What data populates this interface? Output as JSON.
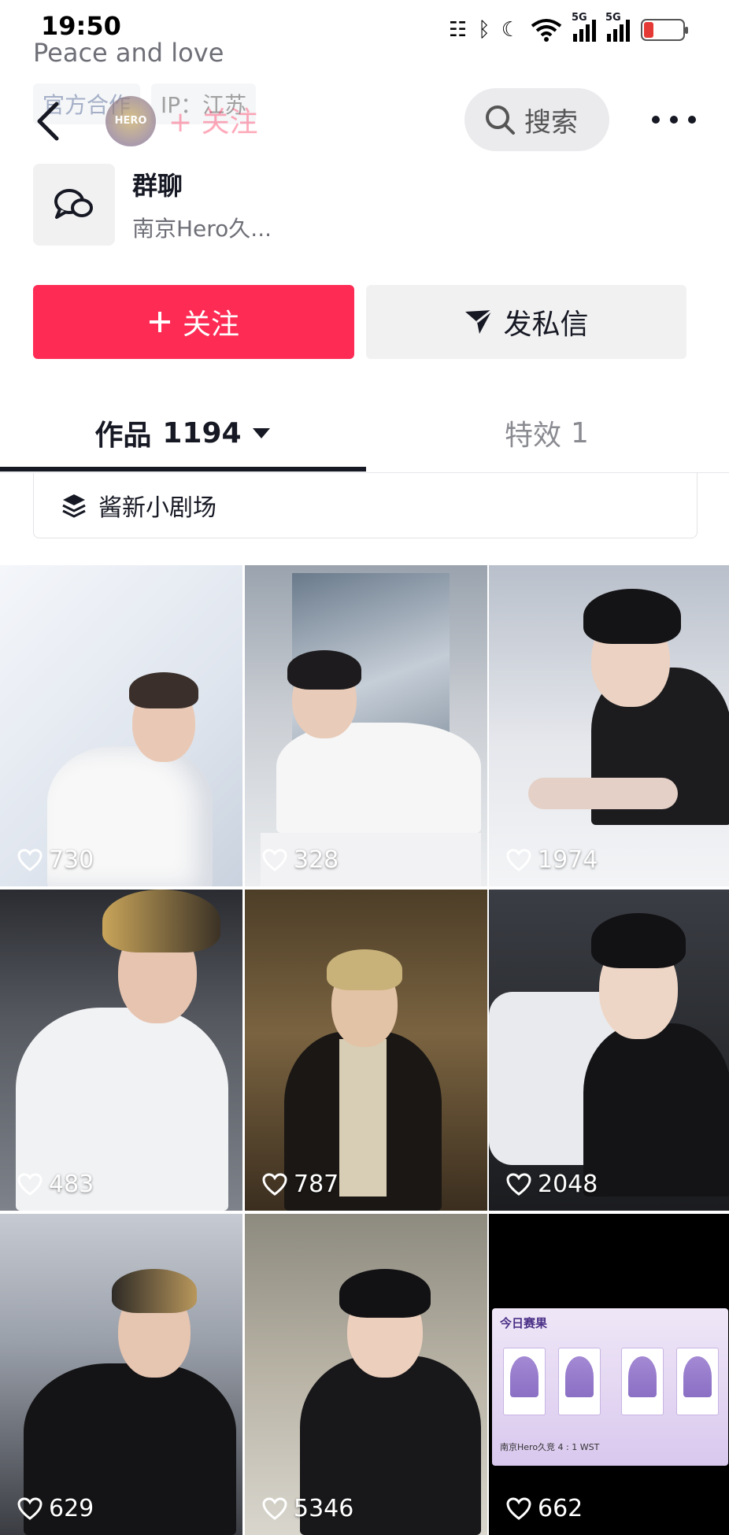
{
  "status_bar": {
    "time": "19:50",
    "battery": "20",
    "network_1": "5G",
    "network_2": "5G"
  },
  "profile": {
    "bio": "Peace and love",
    "badges": [
      "官方合作",
      "IP：江苏"
    ],
    "mini_avatar_text": "HERO",
    "ghost_follow": "+ 关注"
  },
  "header": {
    "search_label": "搜索"
  },
  "group_chat": {
    "title": "群聊",
    "subtitle": "南京Hero久..."
  },
  "actions": {
    "follow_label": "关注",
    "message_label": "发私信"
  },
  "tabs": {
    "works": {
      "label": "作品",
      "count": "1194"
    },
    "effects": {
      "label": "特效",
      "count": "1"
    }
  },
  "playlist": {
    "label": "酱新小剧场"
  },
  "videos": [
    {
      "likes": "730"
    },
    {
      "likes": "328"
    },
    {
      "likes": "1974"
    },
    {
      "likes": "483"
    },
    {
      "likes": "787"
    },
    {
      "likes": "2048"
    },
    {
      "likes": "629"
    },
    {
      "likes": "5346"
    },
    {
      "likes": "662"
    }
  ],
  "score_card": {
    "title": "今日赛果",
    "line": "南京Hero久竞 4 : 1 WST"
  },
  "colors": {
    "accent": "#fe2c55",
    "text": "#161823",
    "muted": "#8a8b91"
  },
  "icons": {
    "back": "back-chevron-icon",
    "search": "search-icon",
    "more": "more-dots-icon",
    "group": "chat-bubbles-icon",
    "plus": "plus-icon",
    "send": "paper-plane-icon",
    "playlist": "layers-icon",
    "heart": "heart-outline-icon"
  }
}
